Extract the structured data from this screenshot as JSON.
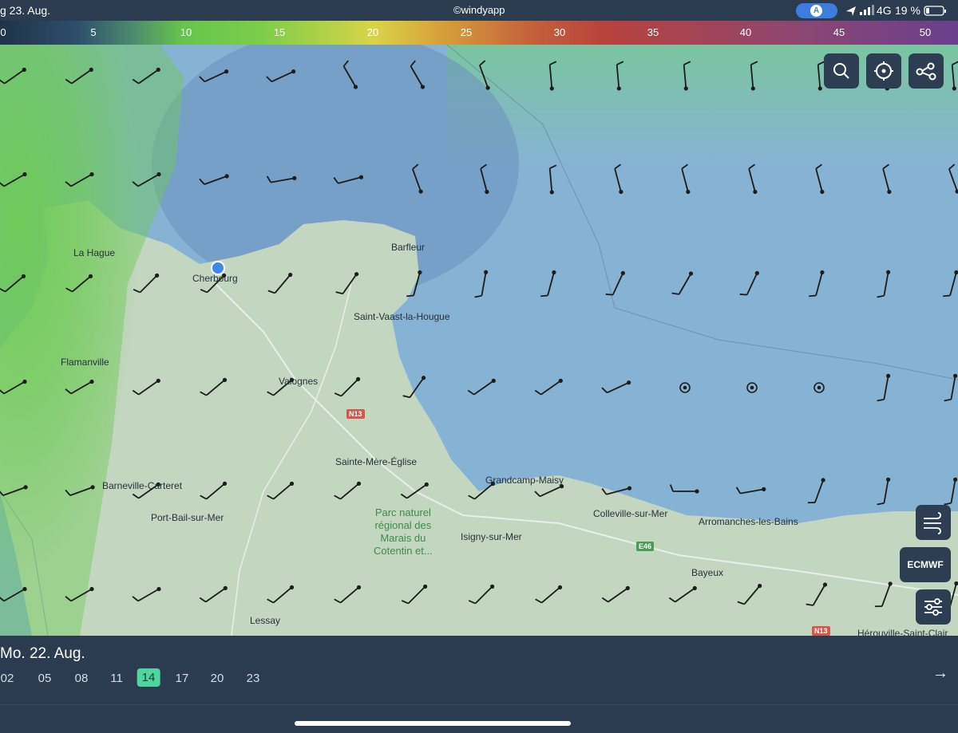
{
  "status_bar": {
    "date": "g 23. Aug.",
    "app": "©windyapp",
    "carrier": "4G",
    "battery": "19 %",
    "nav_glyph": "A"
  },
  "scale": {
    "ticks": [
      "0",
      "5",
      "10",
      "15",
      "20",
      "25",
      "30",
      "35",
      "40",
      "45",
      "50"
    ]
  },
  "map": {
    "labels": {
      "la_hague": "La Hague",
      "cherbourg": "Cherbourg",
      "barfleur": "Barfleur",
      "saint_vaast": "Saint-Vaast-la-Hougue",
      "flamanville": "Flamanville",
      "valognes": "Valognes",
      "sainte_mere": "Sainte-Mère-Église",
      "barneville": "Barneville-Carteret",
      "grandcamp": "Grandcamp-Maisy",
      "port_bail": "Port-Bail-sur-Mer",
      "colleville": "Colleville-sur-Mer",
      "arromanches": "Arromanches-les-Bains",
      "isigny": "Isigny-sur-Mer",
      "bayeux": "Bayeux",
      "lessay": "Lessay",
      "herouville": "Hérouville-Saint-Clair",
      "park_1": "Parc naturel",
      "park_2": "régional des",
      "park_3": "Marais du",
      "park_4": "Cotentin et..."
    },
    "roads": {
      "n13_a": "N13",
      "e46": "E46",
      "n13_b": "N13"
    },
    "buttons": {
      "search": "search-icon",
      "locate": "crosshair-locate-icon",
      "share": "route-nodes-icon",
      "wind_layer": "wind-icon",
      "model": "ECMWF",
      "settings": "sliders-icon"
    },
    "colors": {
      "sea": "#89b6d6",
      "land": "#c9dcc4",
      "wind_low": "#6cc655",
      "arrow": "#1c1c1c"
    }
  },
  "timeline": {
    "day": "Mo. 22. Aug.",
    "hours": [
      "02",
      "05",
      "08",
      "11",
      "14",
      "17",
      "20",
      "23"
    ],
    "selected_hour": "14",
    "arrow": "→"
  }
}
